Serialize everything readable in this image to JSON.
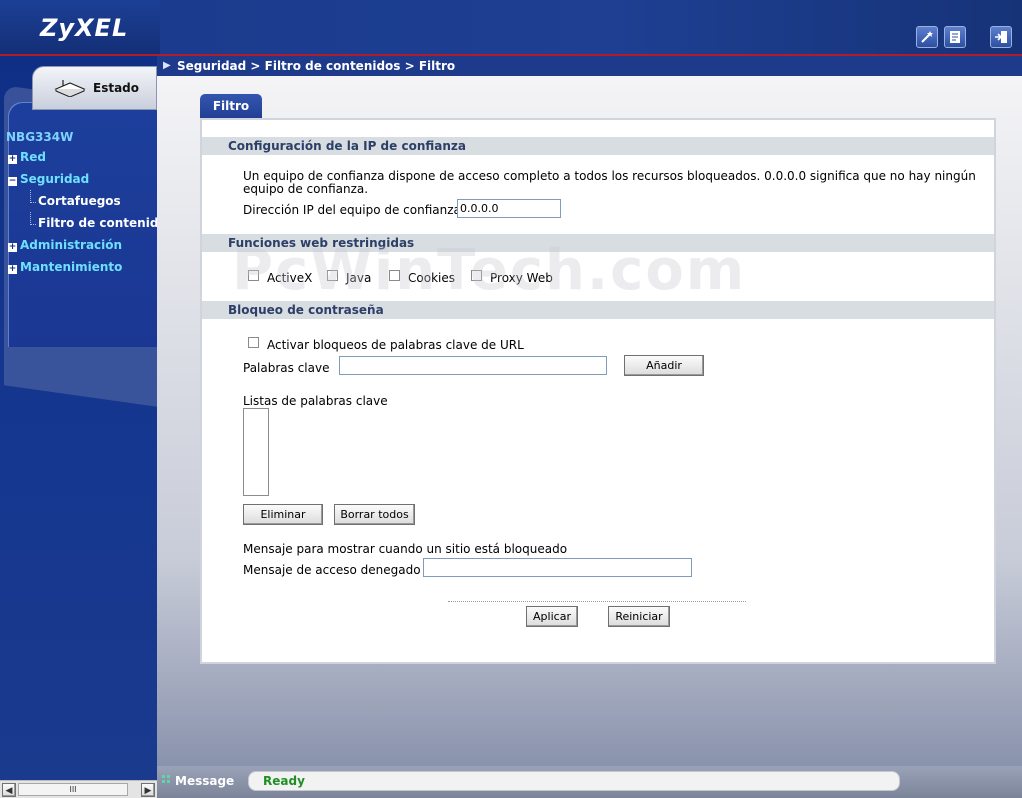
{
  "header": {
    "logo": "ZyXEL",
    "icons": [
      "wizard-icon",
      "notes-icon",
      "logout-icon"
    ]
  },
  "breadcrumb": "Seguridad > Filtro de contenidos > Filtro",
  "sidebar": {
    "tab_label": "Estado",
    "device": "NBG334W",
    "items": [
      {
        "label": "Red",
        "expander": "+"
      },
      {
        "label": "Seguridad",
        "expander": "−"
      },
      {
        "label": "Cortafuegos"
      },
      {
        "label": "Filtro de contenido"
      },
      {
        "label": "Administración",
        "expander": "+"
      },
      {
        "label": "Mantenimiento",
        "expander": "+"
      }
    ],
    "scroll_thumb": "III"
  },
  "tab": "Filtro",
  "trusted_ip": {
    "title": "Configuración de la IP de confianza",
    "description_line1": "Un equipo de confianza dispone de acceso completo a todos los recursos bloqueados. 0.0.0.0 significa que no hay ningún",
    "description_line2": "equipo de confianza.",
    "ip_label": "Dirección IP del equipo de confianza:",
    "ip_value": "0.0.0.0"
  },
  "restricted_web": {
    "title": "Funciones web restringidas",
    "options": [
      "ActiveX",
      "Java",
      "Cookies",
      "Proxy Web"
    ]
  },
  "keyword_blocking": {
    "title": "Bloqueo de contraseña",
    "enable_label": "Activar bloqueos de palabras clave de URL",
    "keywords_label": "Palabras clave",
    "keywords_value": "",
    "add_button": "Añadir",
    "list_label": "Listas de palabras clave",
    "delete_button": "Eliminar",
    "clear_all_button": "Borrar todos",
    "message_intro": "Mensaje para mostrar cuando un sitio está bloqueado",
    "denied_label": "Mensaje de acceso denegado",
    "denied_value": ""
  },
  "actions": {
    "apply": "Aplicar",
    "reset": "Reiniciar"
  },
  "watermark": "PcWinTech.com",
  "status": {
    "label": "Message",
    "value": "Ready"
  }
}
